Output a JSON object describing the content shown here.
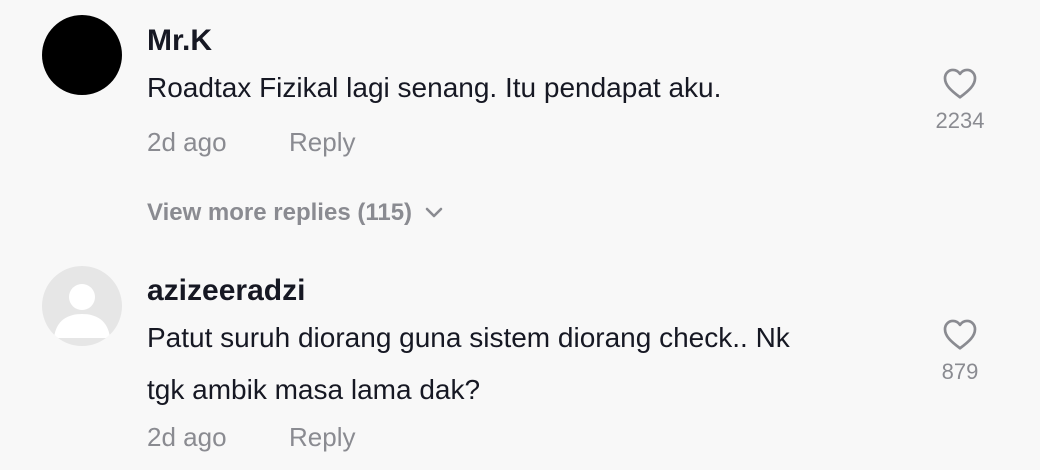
{
  "comments": [
    {
      "username": "Mr.K",
      "text_lines": [
        "Roadtax Fizikal lagi senang. Itu pendapat aku."
      ],
      "time": "2d ago",
      "reply_label": "Reply",
      "like_count": "2234",
      "avatar": "black-circle",
      "view_more": "View more replies (115)"
    },
    {
      "username": "azizeeradzi",
      "text_lines": [
        "Patut suruh diorang guna sistem diorang check.. Nk",
        "tgk ambik masa lama dak?"
      ],
      "time": "2d ago",
      "reply_label": "Reply",
      "like_count": "879",
      "avatar": "default-user-icon"
    }
  ],
  "icons": {
    "like": "heart-outline-icon",
    "expand": "chevron-down-icon"
  },
  "colors": {
    "background": "#f8f8f8",
    "username": "#161823",
    "text": "#161823",
    "muted": "#8a8b91"
  }
}
